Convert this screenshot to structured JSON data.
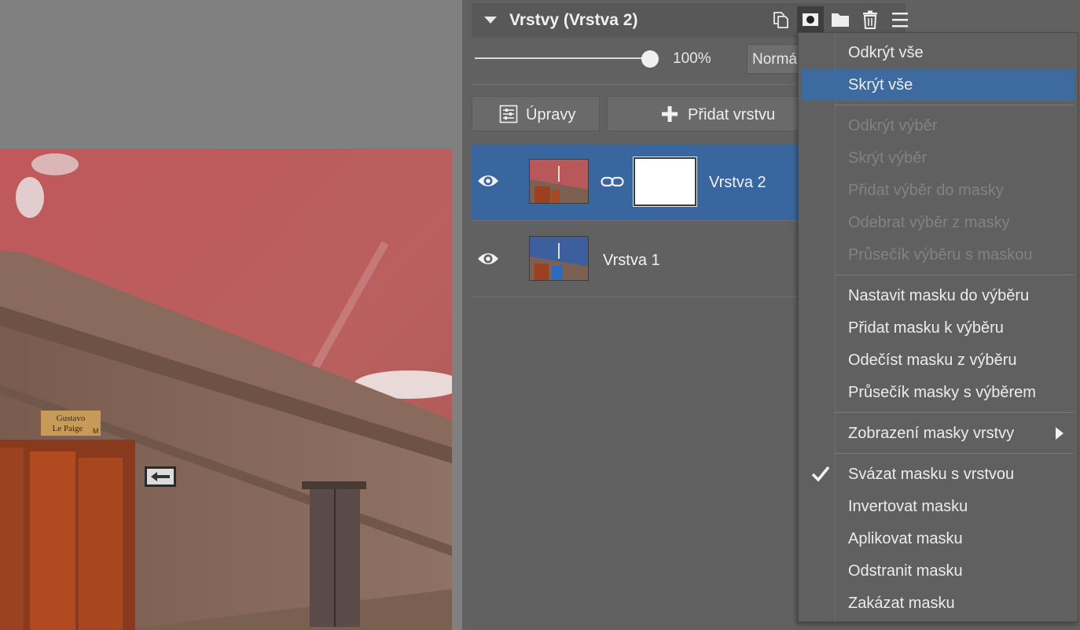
{
  "panel": {
    "title": "Vrstvy (Vrstva 2)",
    "opacity": "100%",
    "blend_mode": "Normál",
    "adjust_button": "Úpravy",
    "add_layer_button": "Přidat vrstvu",
    "header_icons": [
      "copy-layer-icon",
      "mask-icon",
      "folder-icon",
      "trash-icon",
      "hamburger-menu-icon"
    ]
  },
  "layers": [
    {
      "name": "Vrstva 2",
      "selected": true,
      "has_mask": true,
      "visible": true
    },
    {
      "name": "Vrstva 1",
      "selected": false,
      "has_mask": false,
      "visible": true
    }
  ],
  "menu": {
    "groups": [
      [
        {
          "label": "Odkrýt vše",
          "enabled": true,
          "highlighted": false
        },
        {
          "label": "Skrýt vše",
          "enabled": true,
          "highlighted": true
        }
      ],
      [
        {
          "label": "Odkrýt výběr",
          "enabled": false
        },
        {
          "label": "Skrýt výběr",
          "enabled": false
        },
        {
          "label": "Přidat výběr do masky",
          "enabled": false
        },
        {
          "label": "Odebrat výběr z masky",
          "enabled": false
        },
        {
          "label": "Průsečík výběru s maskou",
          "enabled": false
        }
      ],
      [
        {
          "label": "Nastavit masku do výběru",
          "enabled": true
        },
        {
          "label": "Přidat masku k výběru",
          "enabled": true
        },
        {
          "label": "Odečíst masku z výběru",
          "enabled": true
        },
        {
          "label": "Průsečík masky s výběrem",
          "enabled": true
        }
      ],
      [
        {
          "label": "Zobrazení masky vrstvy",
          "enabled": true,
          "submenu": true
        }
      ],
      [
        {
          "label": "Svázat masku s vrstvou",
          "enabled": true,
          "checked": true
        },
        {
          "label": "Invertovat masku",
          "enabled": true
        },
        {
          "label": "Aplikovat masku",
          "enabled": true
        },
        {
          "label": "Odstranit masku",
          "enabled": true
        },
        {
          "label": "Zakázat masku",
          "enabled": true
        }
      ]
    ]
  },
  "photo": {
    "sign_text_1": "Gustavo",
    "sign_text_2": "Le Paige",
    "sign_text_3": "M"
  },
  "colors": {
    "panel_bg": "#616161",
    "selection": "#3a66a0",
    "menu_highlight": "#3d6ba0",
    "sky": "#b45c5c",
    "wall": "#8a6a5a"
  }
}
